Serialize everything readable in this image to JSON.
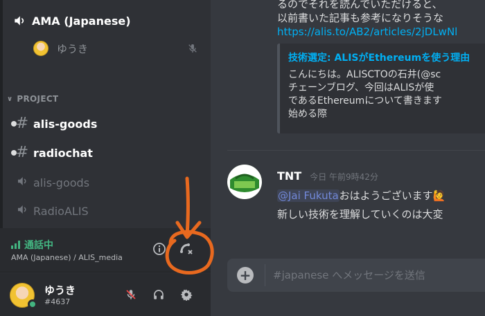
{
  "sidebar": {
    "voice_channel": {
      "name": "AMA (Japanese)",
      "icon": "speaker-icon"
    },
    "voice_user": {
      "name": "ゆうき",
      "avatar": "avatar",
      "status_icon": "muted-mic-icon"
    },
    "category": {
      "label": "PROJECT",
      "icon": "chevron-down-icon"
    },
    "channels": [
      {
        "name": "alis-goods",
        "type": "text",
        "unread": true
      },
      {
        "name": "radiochat",
        "type": "text",
        "unread": true
      },
      {
        "name": "alis-goods",
        "type": "voice",
        "unread": false
      },
      {
        "name": "RadioALIS",
        "type": "voice",
        "unread": false
      }
    ]
  },
  "voice_panel": {
    "status": "通話中",
    "location": "AMA (Japanese) / ALIS_media",
    "status_color": "#43b581"
  },
  "user_panel": {
    "username": "ゆうき",
    "tag": "#4637",
    "online_color": "#43b581"
  },
  "chat": {
    "message1": {
      "line1": "るのでそれを読んでいただけると、",
      "line2": "以前書いた記事も参考になりそうな",
      "link": "https://alis.to/AB2/articles/2jDLwNl"
    },
    "embed": {
      "title": "技術選定: ALISがEthereumを使う理由",
      "desc1": "こんにちは。ALISCTOの石井(@sc",
      "desc2": "チェーンブログ、今回はALISが使",
      "desc3": "であるEthereumについて書きます",
      "desc4": "始める際"
    },
    "message2": {
      "author": "TNT",
      "timestamp": "今日 午前9時42分",
      "mention": "@Jai Fukuta",
      "text1": "おはようございます",
      "emoji": "🙋",
      "text2": "新しい技術を理解していくのは大変"
    },
    "input": {
      "placeholder": "#japanese へメッセージを送信"
    }
  },
  "annotation": {
    "color": "#e8691f"
  }
}
